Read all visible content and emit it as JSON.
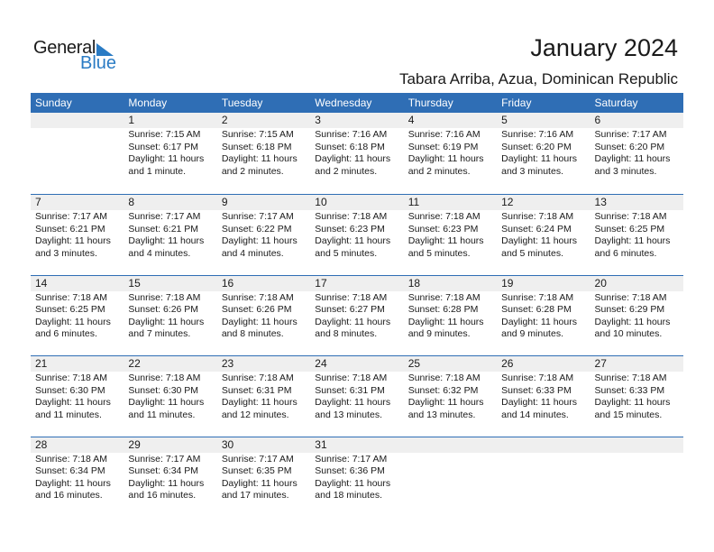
{
  "logo": {
    "word1": "General",
    "word2": "Blue",
    "icon": "triangle-flag-icon",
    "accent": "#2a7bc4"
  },
  "header": {
    "title": "January 2024",
    "location": "Tabara Arriba, Azua, Dominican Republic"
  },
  "colors": {
    "header_bg": "#2f6eb5",
    "day_number_bg": "#efefef"
  },
  "weekdays": [
    "Sunday",
    "Monday",
    "Tuesday",
    "Wednesday",
    "Thursday",
    "Friday",
    "Saturday"
  ],
  "weeks": [
    [
      null,
      {
        "day": "1",
        "sunrise": "Sunrise: 7:15 AM",
        "sunset": "Sunset: 6:17 PM",
        "daylight1": "Daylight: 11 hours",
        "daylight2": "and 1 minute."
      },
      {
        "day": "2",
        "sunrise": "Sunrise: 7:15 AM",
        "sunset": "Sunset: 6:18 PM",
        "daylight1": "Daylight: 11 hours",
        "daylight2": "and 2 minutes."
      },
      {
        "day": "3",
        "sunrise": "Sunrise: 7:16 AM",
        "sunset": "Sunset: 6:18 PM",
        "daylight1": "Daylight: 11 hours",
        "daylight2": "and 2 minutes."
      },
      {
        "day": "4",
        "sunrise": "Sunrise: 7:16 AM",
        "sunset": "Sunset: 6:19 PM",
        "daylight1": "Daylight: 11 hours",
        "daylight2": "and 2 minutes."
      },
      {
        "day": "5",
        "sunrise": "Sunrise: 7:16 AM",
        "sunset": "Sunset: 6:20 PM",
        "daylight1": "Daylight: 11 hours",
        "daylight2": "and 3 minutes."
      },
      {
        "day": "6",
        "sunrise": "Sunrise: 7:17 AM",
        "sunset": "Sunset: 6:20 PM",
        "daylight1": "Daylight: 11 hours",
        "daylight2": "and 3 minutes."
      }
    ],
    [
      {
        "day": "7",
        "sunrise": "Sunrise: 7:17 AM",
        "sunset": "Sunset: 6:21 PM",
        "daylight1": "Daylight: 11 hours",
        "daylight2": "and 3 minutes."
      },
      {
        "day": "8",
        "sunrise": "Sunrise: 7:17 AM",
        "sunset": "Sunset: 6:21 PM",
        "daylight1": "Daylight: 11 hours",
        "daylight2": "and 4 minutes."
      },
      {
        "day": "9",
        "sunrise": "Sunrise: 7:17 AM",
        "sunset": "Sunset: 6:22 PM",
        "daylight1": "Daylight: 11 hours",
        "daylight2": "and 4 minutes."
      },
      {
        "day": "10",
        "sunrise": "Sunrise: 7:18 AM",
        "sunset": "Sunset: 6:23 PM",
        "daylight1": "Daylight: 11 hours",
        "daylight2": "and 5 minutes."
      },
      {
        "day": "11",
        "sunrise": "Sunrise: 7:18 AM",
        "sunset": "Sunset: 6:23 PM",
        "daylight1": "Daylight: 11 hours",
        "daylight2": "and 5 minutes."
      },
      {
        "day": "12",
        "sunrise": "Sunrise: 7:18 AM",
        "sunset": "Sunset: 6:24 PM",
        "daylight1": "Daylight: 11 hours",
        "daylight2": "and 5 minutes."
      },
      {
        "day": "13",
        "sunrise": "Sunrise: 7:18 AM",
        "sunset": "Sunset: 6:25 PM",
        "daylight1": "Daylight: 11 hours",
        "daylight2": "and 6 minutes."
      }
    ],
    [
      {
        "day": "14",
        "sunrise": "Sunrise: 7:18 AM",
        "sunset": "Sunset: 6:25 PM",
        "daylight1": "Daylight: 11 hours",
        "daylight2": "and 6 minutes."
      },
      {
        "day": "15",
        "sunrise": "Sunrise: 7:18 AM",
        "sunset": "Sunset: 6:26 PM",
        "daylight1": "Daylight: 11 hours",
        "daylight2": "and 7 minutes."
      },
      {
        "day": "16",
        "sunrise": "Sunrise: 7:18 AM",
        "sunset": "Sunset: 6:26 PM",
        "daylight1": "Daylight: 11 hours",
        "daylight2": "and 8 minutes."
      },
      {
        "day": "17",
        "sunrise": "Sunrise: 7:18 AM",
        "sunset": "Sunset: 6:27 PM",
        "daylight1": "Daylight: 11 hours",
        "daylight2": "and 8 minutes."
      },
      {
        "day": "18",
        "sunrise": "Sunrise: 7:18 AM",
        "sunset": "Sunset: 6:28 PM",
        "daylight1": "Daylight: 11 hours",
        "daylight2": "and 9 minutes."
      },
      {
        "day": "19",
        "sunrise": "Sunrise: 7:18 AM",
        "sunset": "Sunset: 6:28 PM",
        "daylight1": "Daylight: 11 hours",
        "daylight2": "and 9 minutes."
      },
      {
        "day": "20",
        "sunrise": "Sunrise: 7:18 AM",
        "sunset": "Sunset: 6:29 PM",
        "daylight1": "Daylight: 11 hours",
        "daylight2": "and 10 minutes."
      }
    ],
    [
      {
        "day": "21",
        "sunrise": "Sunrise: 7:18 AM",
        "sunset": "Sunset: 6:30 PM",
        "daylight1": "Daylight: 11 hours",
        "daylight2": "and 11 minutes."
      },
      {
        "day": "22",
        "sunrise": "Sunrise: 7:18 AM",
        "sunset": "Sunset: 6:30 PM",
        "daylight1": "Daylight: 11 hours",
        "daylight2": "and 11 minutes."
      },
      {
        "day": "23",
        "sunrise": "Sunrise: 7:18 AM",
        "sunset": "Sunset: 6:31 PM",
        "daylight1": "Daylight: 11 hours",
        "daylight2": "and 12 minutes."
      },
      {
        "day": "24",
        "sunrise": "Sunrise: 7:18 AM",
        "sunset": "Sunset: 6:31 PM",
        "daylight1": "Daylight: 11 hours",
        "daylight2": "and 13 minutes."
      },
      {
        "day": "25",
        "sunrise": "Sunrise: 7:18 AM",
        "sunset": "Sunset: 6:32 PM",
        "daylight1": "Daylight: 11 hours",
        "daylight2": "and 13 minutes."
      },
      {
        "day": "26",
        "sunrise": "Sunrise: 7:18 AM",
        "sunset": "Sunset: 6:33 PM",
        "daylight1": "Daylight: 11 hours",
        "daylight2": "and 14 minutes."
      },
      {
        "day": "27",
        "sunrise": "Sunrise: 7:18 AM",
        "sunset": "Sunset: 6:33 PM",
        "daylight1": "Daylight: 11 hours",
        "daylight2": "and 15 minutes."
      }
    ],
    [
      {
        "day": "28",
        "sunrise": "Sunrise: 7:18 AM",
        "sunset": "Sunset: 6:34 PM",
        "daylight1": "Daylight: 11 hours",
        "daylight2": "and 16 minutes."
      },
      {
        "day": "29",
        "sunrise": "Sunrise: 7:17 AM",
        "sunset": "Sunset: 6:34 PM",
        "daylight1": "Daylight: 11 hours",
        "daylight2": "and 16 minutes."
      },
      {
        "day": "30",
        "sunrise": "Sunrise: 7:17 AM",
        "sunset": "Sunset: 6:35 PM",
        "daylight1": "Daylight: 11 hours",
        "daylight2": "and 17 minutes."
      },
      {
        "day": "31",
        "sunrise": "Sunrise: 7:17 AM",
        "sunset": "Sunset: 6:36 PM",
        "daylight1": "Daylight: 11 hours",
        "daylight2": "and 18 minutes."
      },
      null,
      null,
      null
    ]
  ]
}
